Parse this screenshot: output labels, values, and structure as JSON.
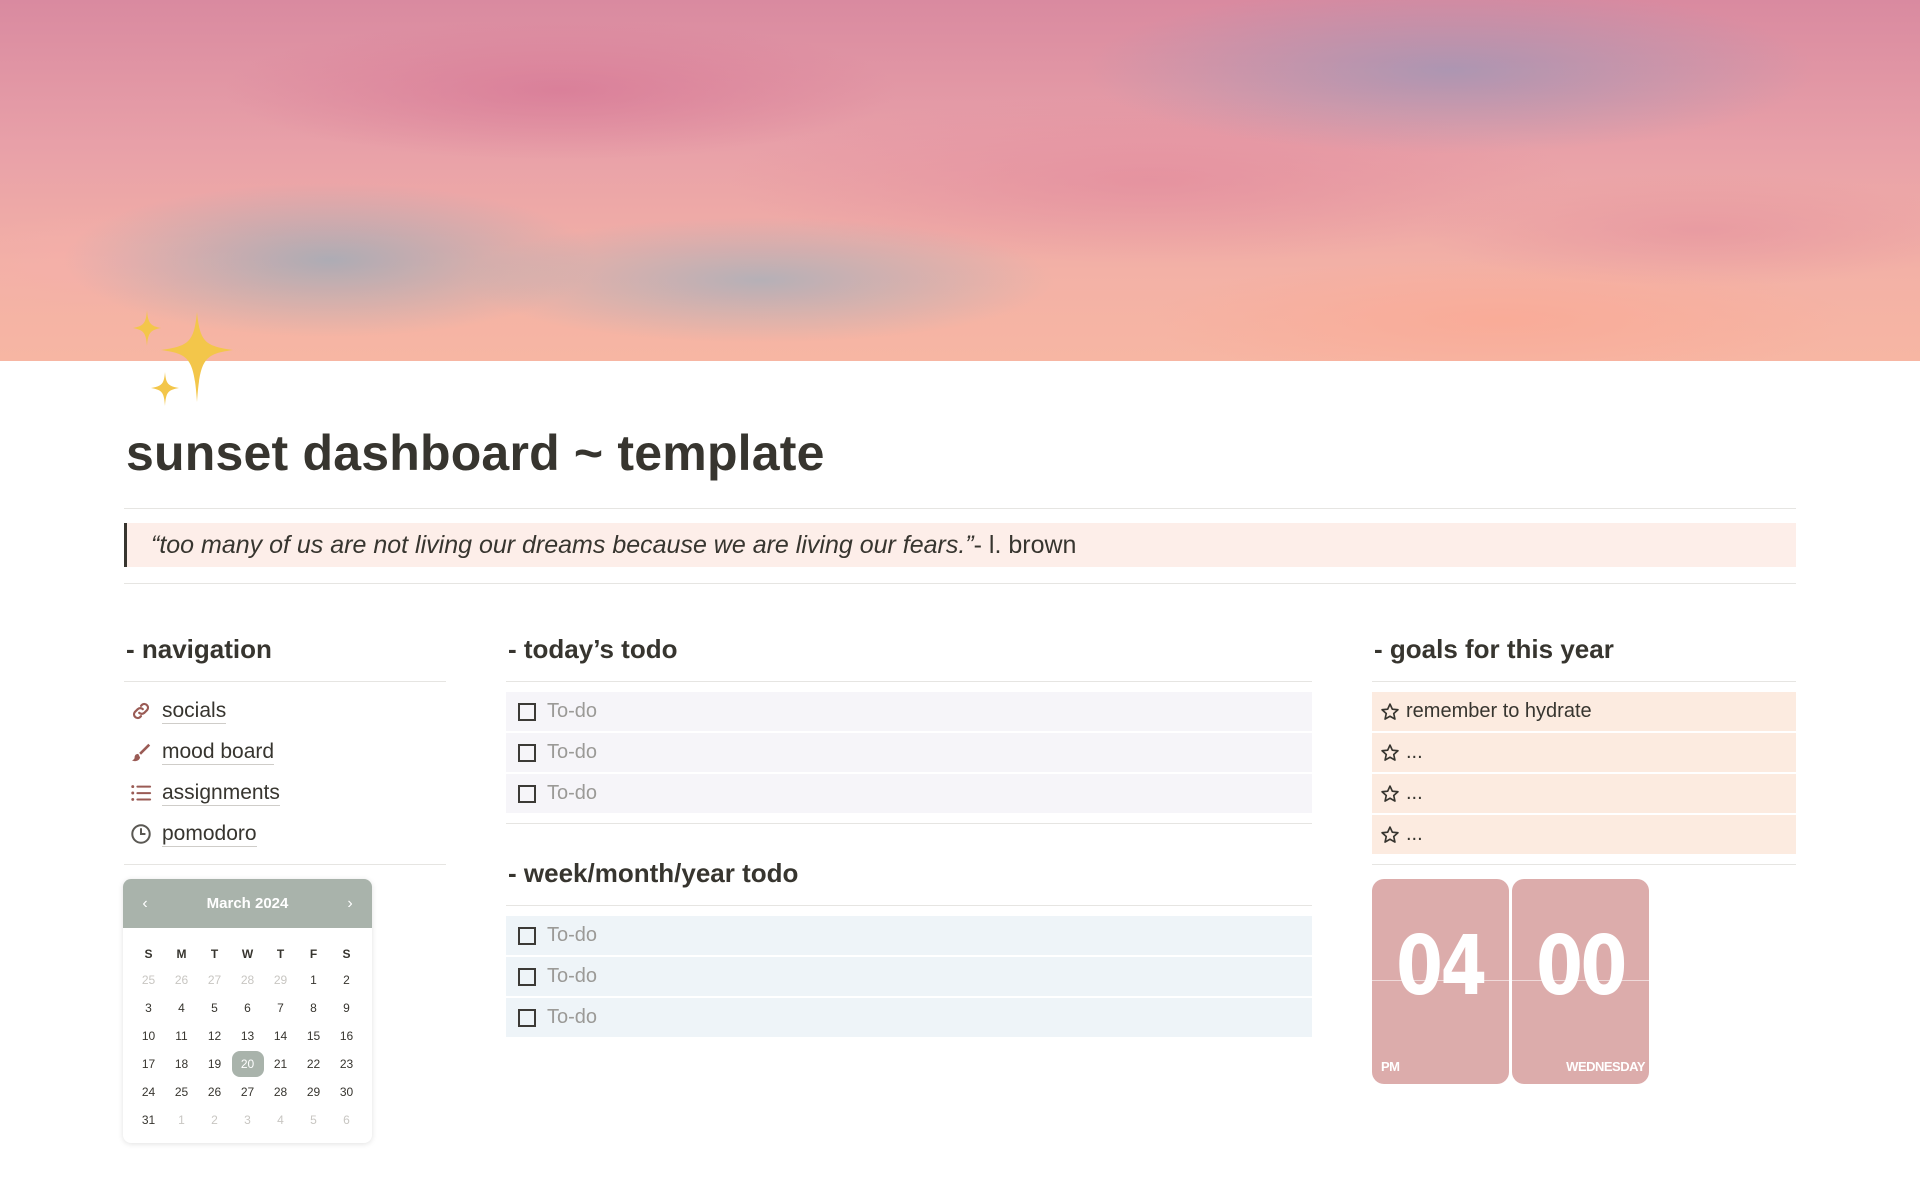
{
  "page": {
    "title": "sunset dashboard ~ template",
    "quote": {
      "text": "“too many of us are not living our dreams because we are living our fears.”",
      "attribution": " - l. brown"
    }
  },
  "navigation": {
    "title": "- navigation",
    "items": [
      {
        "label": "socials",
        "icon": "link-icon"
      },
      {
        "label": "mood board",
        "icon": "paintbrush-icon"
      },
      {
        "label": "assignments",
        "icon": "list-icon"
      },
      {
        "label": "pomodoro",
        "icon": "clock-icon"
      }
    ]
  },
  "calendar": {
    "month": "March 2024",
    "weekdays": [
      "S",
      "M",
      "T",
      "W",
      "T",
      "F",
      "S"
    ],
    "weeks": [
      [
        "25",
        "26",
        "27",
        "28",
        "29",
        "1",
        "2"
      ],
      [
        "3",
        "4",
        "5",
        "6",
        "7",
        "8",
        "9"
      ],
      [
        "10",
        "11",
        "12",
        "13",
        "14",
        "15",
        "16"
      ],
      [
        "17",
        "18",
        "19",
        "20",
        "21",
        "22",
        "23"
      ],
      [
        "24",
        "25",
        "26",
        "27",
        "28",
        "29",
        "30"
      ],
      [
        "31",
        "1",
        "2",
        "3",
        "4",
        "5",
        "6"
      ]
    ],
    "today": "20",
    "accent_color": "#a9b3ab"
  },
  "today_todo": {
    "title": "- today’s todo",
    "items": [
      "To-do",
      "To-do",
      "To-do"
    ]
  },
  "period_todo": {
    "title": "- week/month/year todo",
    "items": [
      "To-do",
      "To-do",
      "To-do"
    ]
  },
  "goals": {
    "title": "- goals for this year",
    "items": [
      "remember to hydrate",
      "...",
      "...",
      "..."
    ],
    "icon": "star-outline-icon"
  },
  "clock": {
    "hour": "04",
    "minute": "00",
    "meridiem": "PM",
    "weekday": "WEDNESDAY",
    "color": "#dcacab"
  }
}
